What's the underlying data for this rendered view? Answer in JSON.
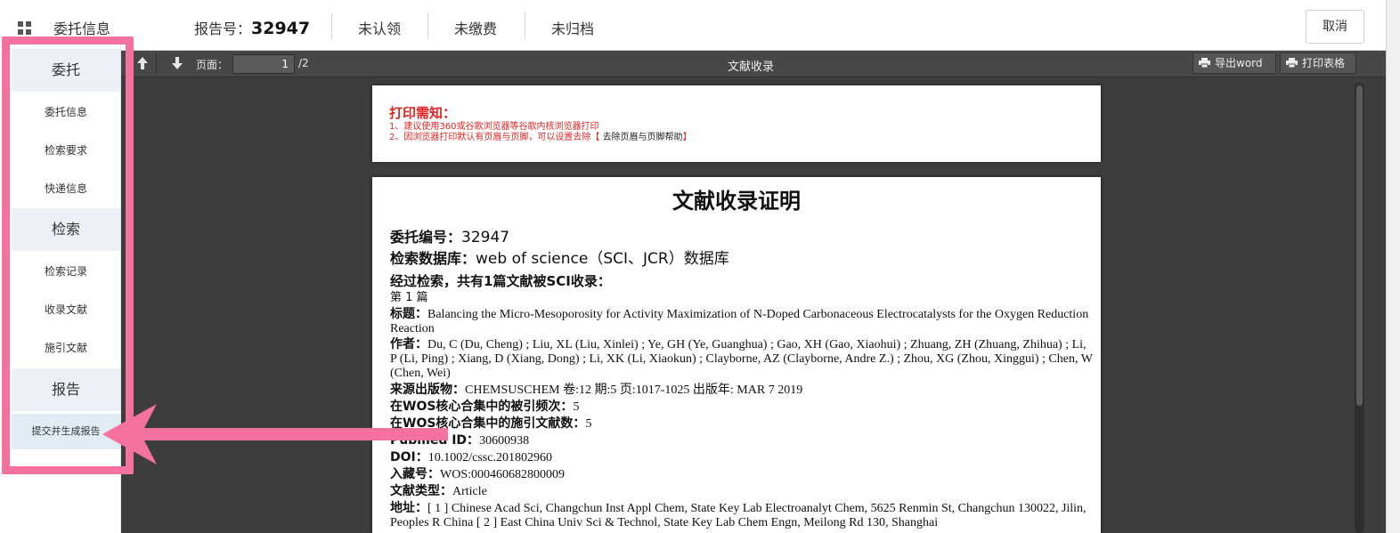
{
  "header": {
    "menu_icon": "grid-icon",
    "title": "委托信息",
    "report_label": "报告号：",
    "report_number": "32947",
    "statuses": [
      "未认领",
      "未缴费",
      "未归档"
    ],
    "cancel_label": "取消"
  },
  "sidebar": {
    "sections": [
      {
        "title": "委托",
        "items": [
          "委托信息",
          "检索要求",
          "快递信息"
        ]
      },
      {
        "title": "检索",
        "items": [
          "检索记录",
          "收录文献",
          "施引文献"
        ]
      },
      {
        "title": "报告",
        "items": [
          "提交并生成报告"
        ]
      }
    ],
    "active_item": "提交并生成报告"
  },
  "annotation": {
    "highlight_color": "#f5729e"
  },
  "toolbar": {
    "page_label": "页面：",
    "page_value": "1",
    "page_total": "/2",
    "title": "文献收录",
    "export_word": "导出word",
    "print_table": "打印表格"
  },
  "notice": {
    "title": "打印需知：",
    "line1": "1、建议使用360或谷歌浏览器等谷歌内核浏览器打印",
    "line2_prefix": "2、因浏览器打印默认有页眉与页脚，可以设置去除【",
    "line2_link": "去除页眉与页脚帮助",
    "line2_suffix": "】"
  },
  "document": {
    "title": "文献收录证明",
    "entrust_label": "委托编号：",
    "entrust_no": "32947",
    "db_label": "检索数据库：",
    "db_value": "web of science（SCI、JCR）数据库",
    "summary": "经过检索，共有1篇文献被SCI收录：",
    "article_index": "第 1 篇",
    "title_label": "标题：",
    "title_value": "Balancing the Micro-Mesoporosity for Activity Maximization of N-Doped Carbonaceous Electrocatalysts for the Oxygen Reduction Reaction",
    "author_label": "作者：",
    "author_value": "Du, C (Du, Cheng) ; Liu, XL (Liu, Xinlei) ; Ye, GH (Ye, Guanghua) ; Gao, XH (Gao, Xiaohui) ; Zhuang, ZH (Zhuang, Zhihua) ; Li, P (Li, Ping) ; Xiang, D (Xiang, Dong) ; Li, XK (Li, Xiaokun) ; Clayborne, AZ (Clayborne, Andre Z.) ; Zhou, XG (Zhou, Xinggui) ; Chen, W (Chen, Wei)",
    "source_label": "来源出版物：",
    "source_value": "CHEMSUSCHEM 卷:12 期:5 页:1017-1025 出版年: MAR 7 2019",
    "cited_label": "在WOS核心合集中的被引频次：",
    "cited_value": "5",
    "refs_label": "在WOS核心合集中的施引文献数：",
    "refs_value": "5",
    "pubmed_label": "Pubmed ID：",
    "pubmed_value": "30600938",
    "doi_label": "DOI：",
    "doi_value": "10.1002/cssc.201802960",
    "accession_label": "入藏号：",
    "accession_value": "WOS:000460682800009",
    "type_label": "文献类型：",
    "type_value": "Article",
    "address_label": "地址：",
    "address_value": "[ 1 ] Chinese Acad Sci, Changchun Inst Appl Chem, State Key Lab Electroanalyt Chem, 5625 Renmin St, Changchun 130022, Jilin, Peoples R China [ 2 ] East China Univ Sci & Technol, State Key Lab Chem Engn, Meilong Rd 130, Shanghai"
  }
}
